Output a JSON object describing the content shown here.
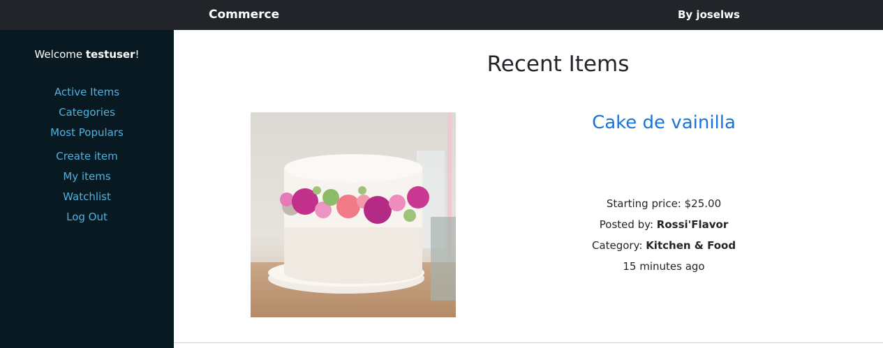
{
  "topbar": {
    "brand": "Commerce",
    "author": "By joselws"
  },
  "sidebar": {
    "welcome_prefix": "Welcome ",
    "username": "testuser",
    "welcome_suffix": "!",
    "links": [
      {
        "label": "Active Items"
      },
      {
        "label": "Categories"
      },
      {
        "label": "Most Populars"
      },
      {
        "label": "Create item"
      },
      {
        "label": "My items"
      },
      {
        "label": "Watchlist"
      },
      {
        "label": "Log Out"
      }
    ]
  },
  "main": {
    "title": "Recent Items",
    "items": [
      {
        "title": "Cake de vainilla",
        "price_label": "Starting price: ",
        "price": "$25.00",
        "posted_label": "Posted by: ",
        "posted_by": "Rossi'Flavor",
        "category_label": "Category: ",
        "category": "Kitchen & Food",
        "time": "15 minutes ago"
      }
    ]
  },
  "colors": {
    "topbar": "#212529",
    "sidebar": "#081921",
    "link": "#4fb3e0",
    "item_title": "#1a73d8"
  }
}
